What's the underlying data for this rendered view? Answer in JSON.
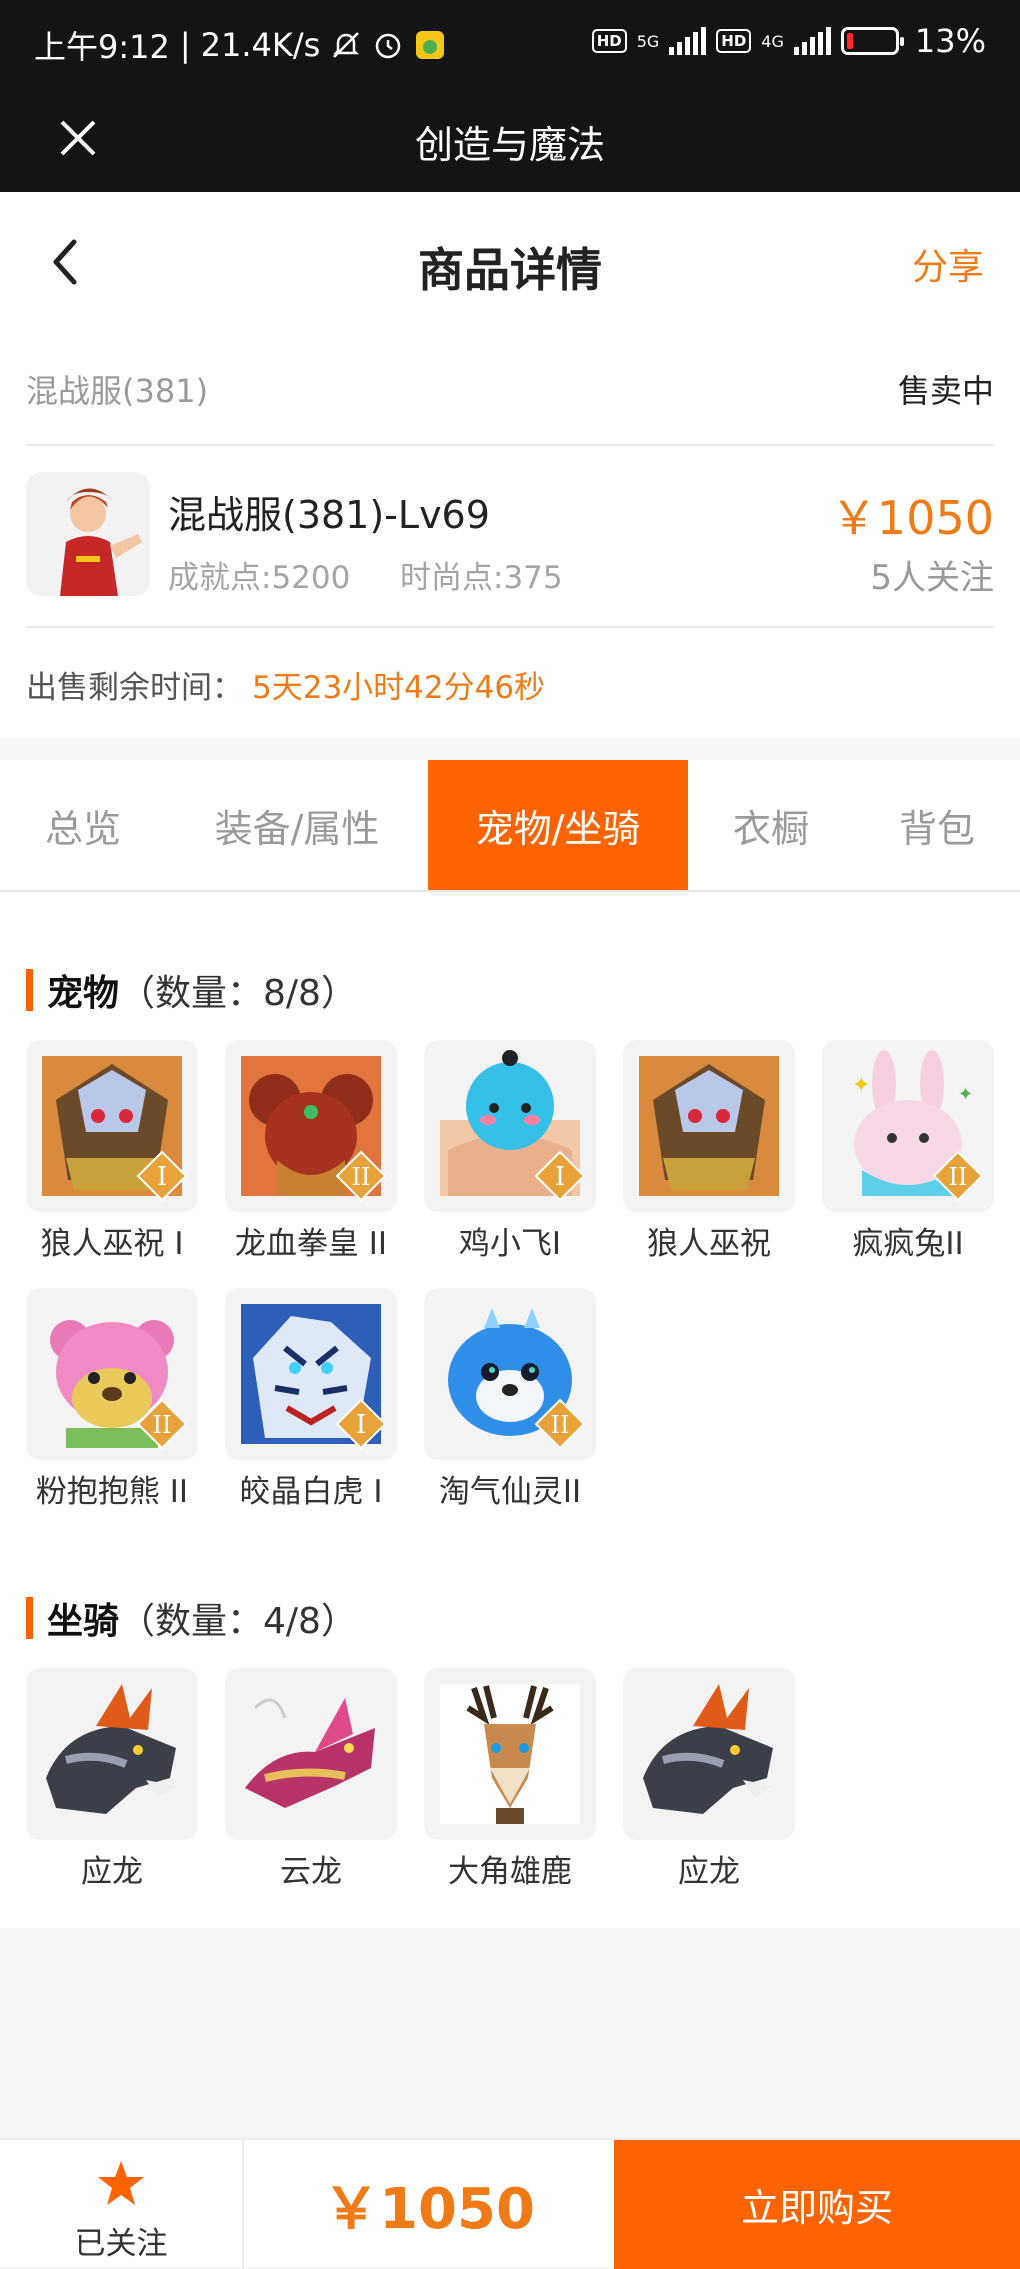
{
  "status_bar": {
    "time": "上午9:12",
    "speed": "21.4K/s",
    "battery": "13%",
    "hd": "HD",
    "net5g": "5G",
    "net4g": "4G"
  },
  "app_bar": {
    "title": "创造与魔法"
  },
  "header": {
    "title": "商品详情",
    "share": "分享"
  },
  "server": {
    "name": "混战服(381)",
    "status": "售卖中"
  },
  "product": {
    "name": "混战服(381)-Lv69",
    "achievement": "成就点:5200",
    "fashion": "时尚点:375",
    "price": "￥1050",
    "followers": "5人关注"
  },
  "remaining": {
    "label": "出售剩余时间：",
    "value": "5天23小时42分46秒"
  },
  "tabs": [
    {
      "label": "总览"
    },
    {
      "label": "装备/属性"
    },
    {
      "label": "宠物/坐骑"
    },
    {
      "label": "衣橱"
    },
    {
      "label": "背包"
    }
  ],
  "pets": {
    "title": "宠物",
    "count": "（数量：8/8）",
    "items": [
      {
        "name": "狼人巫祝 I",
        "icon": "wolf-shaman-pet-icon"
      },
      {
        "name": "龙血拳皇 II",
        "icon": "dragon-boxer-pet-icon"
      },
      {
        "name": "鸡小飞I",
        "icon": "chick-pet-icon"
      },
      {
        "name": "狼人巫祝",
        "icon": "wolf-shaman-pet-icon"
      },
      {
        "name": "疯疯兔II",
        "icon": "rabbit-pet-icon"
      },
      {
        "name": "粉抱抱熊 II",
        "icon": "pink-bear-pet-icon"
      },
      {
        "name": "皎晶白虎 I",
        "icon": "white-tiger-pet-icon"
      },
      {
        "name": "淘气仙灵II",
        "icon": "blue-spirit-pet-icon"
      }
    ]
  },
  "mounts": {
    "title": "坐骑",
    "count": "（数量：4/8）",
    "items": [
      {
        "name": "应龙",
        "icon": "dragon-mount-icon"
      },
      {
        "name": "云龙",
        "icon": "cloud-dragon-mount-icon"
      },
      {
        "name": "大角雄鹿",
        "icon": "deer-mount-icon"
      },
      {
        "name": "应龙",
        "icon": "dragon-mount-icon"
      }
    ]
  },
  "footer": {
    "follow_label": "已关注",
    "price": "￥1050",
    "buy_label": "立即购买"
  },
  "colors": {
    "accent": "#fd6300",
    "price": "#f07b16"
  }
}
